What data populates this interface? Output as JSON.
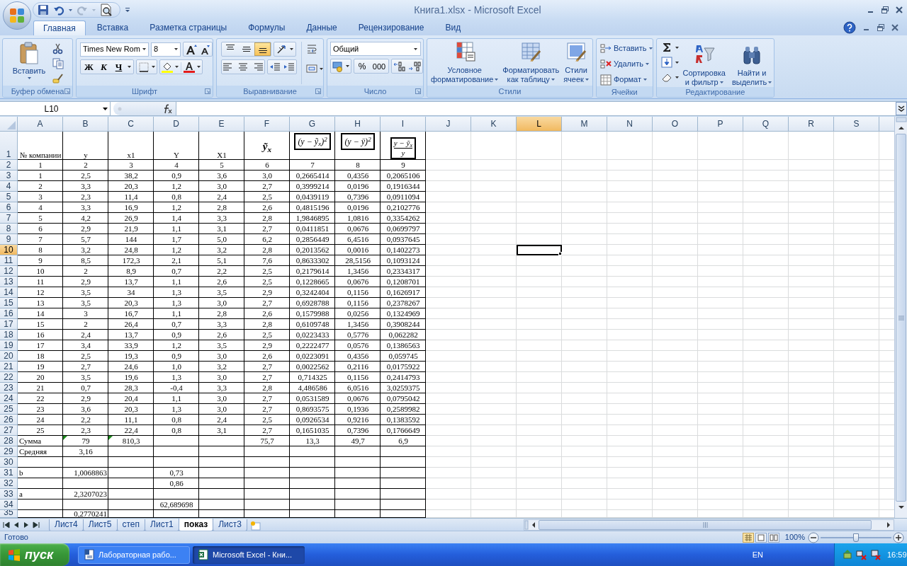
{
  "title_bar": {
    "title": "Книга1.xlsx - Microsoft Excel"
  },
  "tabs": [
    {
      "label": "Главная",
      "selected": true
    },
    {
      "label": "Вставка",
      "selected": false
    },
    {
      "label": "Разметка страницы",
      "selected": false
    },
    {
      "label": "Формулы",
      "selected": false
    },
    {
      "label": "Данные",
      "selected": false
    },
    {
      "label": "Рецензирование",
      "selected": false
    },
    {
      "label": "Вид",
      "selected": false
    }
  ],
  "clipboard": {
    "label": "Буфер обмена",
    "paste": "Вставить"
  },
  "font": {
    "label": "Шрифт",
    "name": "Times New Rom",
    "size": "8",
    "bold": "Ж",
    "italic": "К",
    "underline": "Ч"
  },
  "alignment": {
    "label": "Выравнивание",
    "vertical": [
      {
        "kind": "top",
        "selected": false
      },
      {
        "kind": "middle",
        "selected": false
      },
      {
        "kind": "bottom",
        "selected": true
      }
    ]
  },
  "number": {
    "label": "Число",
    "format": "Общий",
    "percent": "%",
    "thousands": "000"
  },
  "styles": {
    "label": "Стили",
    "buttons": [
      {
        "kind": "conditional",
        "lines": [
          "Условное",
          "форматирование"
        ]
      },
      {
        "kind": "table",
        "lines": [
          "Форматировать",
          "как таблицу"
        ]
      },
      {
        "kind": "cell",
        "lines": [
          "Стили",
          "ячеек"
        ]
      }
    ]
  },
  "cells_group": {
    "label": "Ячейки",
    "buttons": [
      {
        "kind": "insert",
        "label": "Вставить"
      },
      {
        "kind": "delete",
        "label": "Удалить"
      },
      {
        "kind": "format",
        "label": "Формат"
      }
    ]
  },
  "editing": {
    "label": "Редактирование",
    "buttons": [
      {
        "kind": "sort",
        "lines": [
          "Сортировка",
          "и фильтр"
        ]
      },
      {
        "kind": "find",
        "lines": [
          "Найти и",
          "выделить"
        ]
      }
    ]
  },
  "formula_bar": {
    "name_box": "L10"
  },
  "columns": [
    {
      "label": "A",
      "selected": false
    },
    {
      "label": "B",
      "selected": false
    },
    {
      "label": "C",
      "selected": false
    },
    {
      "label": "D",
      "selected": false
    },
    {
      "label": "E",
      "selected": false
    },
    {
      "label": "F",
      "selected": false
    },
    {
      "label": "G",
      "selected": false
    },
    {
      "label": "H",
      "selected": false
    },
    {
      "label": "I",
      "selected": false
    },
    {
      "label": "J",
      "selected": false
    },
    {
      "label": "K",
      "selected": false
    },
    {
      "label": "L",
      "selected": true
    },
    {
      "label": "M",
      "selected": false
    },
    {
      "label": "N",
      "selected": false
    },
    {
      "label": "O",
      "selected": false
    },
    {
      "label": "P",
      "selected": false
    },
    {
      "label": "Q",
      "selected": false
    },
    {
      "label": "R",
      "selected": false
    },
    {
      "label": "S",
      "selected": false
    }
  ],
  "rows": [
    {
      "number": "1",
      "selected": false,
      "kind": "header",
      "headers": [
        {
          "kind": "text",
          "text": "№ компании"
        },
        {
          "kind": "text",
          "text": "y"
        },
        {
          "kind": "text",
          "text": "x1"
        },
        {
          "kind": "text",
          "text": "Y"
        },
        {
          "kind": "text",
          "text": "X1"
        },
        {
          "kind": "symbol",
          "text": "ỹ$_{x}$"
        },
        {
          "kind": "boxed",
          "text": "(y − ỹ$_{x}$)$^{2}$"
        },
        {
          "kind": "boxed",
          "text": "(y − ȳ)$^{2}$"
        },
        {
          "kind": "fraction",
          "numerator": "y − ỹ$_{x}$",
          "denominator": "y"
        }
      ]
    },
    {
      "number": "2",
      "selected": false,
      "kind": "data",
      "cells": [
        "1",
        "2",
        "3",
        "4",
        "5",
        "6",
        "7",
        "8",
        "9"
      ]
    },
    {
      "number": "3",
      "selected": false,
      "kind": "data",
      "cells": [
        "1",
        "2,5",
        "38,2",
        "0,9",
        "3,6",
        "3,0",
        "0,2665414",
        "0,4356",
        "0,2065106"
      ]
    },
    {
      "number": "4",
      "selected": false,
      "kind": "data",
      "cells": [
        "2",
        "3,3",
        "20,3",
        "1,2",
        "3,0",
        "2,7",
        "0,3999214",
        "0,0196",
        "0,1916344"
      ]
    },
    {
      "number": "5",
      "selected": false,
      "kind": "data",
      "cells": [
        "3",
        "2,3",
        "11,4",
        "0,8",
        "2,4",
        "2,5",
        "0,0439119",
        "0,7396",
        "0,0911094"
      ]
    },
    {
      "number": "6",
      "selected": false,
      "kind": "data",
      "cells": [
        "4",
        "3,3",
        "16,9",
        "1,2",
        "2,8",
        "2,6",
        "0,4815196",
        "0,0196",
        "0,2102776"
      ]
    },
    {
      "number": "7",
      "selected": false,
      "kind": "data",
      "cells": [
        "5",
        "4,2",
        "26,9",
        "1,4",
        "3,3",
        "2,8",
        "1,9846895",
        "1,0816",
        "0,3354262"
      ]
    },
    {
      "number": "8",
      "selected": false,
      "kind": "data",
      "cells": [
        "6",
        "2,9",
        "21,9",
        "1,1",
        "3,1",
        "2,7",
        "0,0411851",
        "0,0676",
        "0,0699797"
      ]
    },
    {
      "number": "9",
      "selected": false,
      "kind": "data",
      "cells": [
        "7",
        "5,7",
        "144",
        "1,7",
        "5,0",
        "6,2",
        "0,2856449",
        "6,4516",
        "0,0937645"
      ]
    },
    {
      "number": "10",
      "selected": true,
      "kind": "data",
      "cells": [
        "8",
        "3,2",
        "24,8",
        "1,2",
        "3,2",
        "2,8",
        "0,2013562",
        "0,0016",
        "0,1402273"
      ]
    },
    {
      "number": "11",
      "selected": false,
      "kind": "data",
      "cells": [
        "9",
        "8,5",
        "172,3",
        "2,1",
        "5,1",
        "7,6",
        "0,8633302",
        "28,5156",
        "0,1093124"
      ]
    },
    {
      "number": "12",
      "selected": false,
      "kind": "data",
      "cells": [
        "10",
        "2",
        "8,9",
        "0,7",
        "2,2",
        "2,5",
        "0,2179614",
        "1,3456",
        "0,2334317"
      ]
    },
    {
      "number": "13",
      "selected": false,
      "kind": "data",
      "cells": [
        "11",
        "2,9",
        "13,7",
        "1,1",
        "2,6",
        "2,5",
        "0,1228665",
        "0,0676",
        "0,1208701"
      ]
    },
    {
      "number": "14",
      "selected": false,
      "kind": "data",
      "cells": [
        "12",
        "3,5",
        "34",
        "1,3",
        "3,5",
        "2,9",
        "0,3242404",
        "0,1156",
        "0,1626917"
      ]
    },
    {
      "number": "15",
      "selected": false,
      "kind": "data",
      "cells": [
        "13",
        "3,5",
        "20,3",
        "1,3",
        "3,0",
        "2,7",
        "0,6928788",
        "0,1156",
        "0,2378267"
      ]
    },
    {
      "number": "16",
      "selected": false,
      "kind": "data",
      "cells": [
        "14",
        "3",
        "16,7",
        "1,1",
        "2,8",
        "2,6",
        "0,1579988",
        "0,0256",
        "0,1324969"
      ]
    },
    {
      "number": "17",
      "selected": false,
      "kind": "data",
      "cells": [
        "15",
        "2",
        "26,4",
        "0,7",
        "3,3",
        "2,8",
        "0,6109748",
        "1,3456",
        "0,3908244"
      ]
    },
    {
      "number": "18",
      "selected": false,
      "kind": "data",
      "cells": [
        "16",
        "2,4",
        "13,7",
        "0,9",
        "2,6",
        "2,5",
        "0,0223433",
        "0,5776",
        "0,062282"
      ]
    },
    {
      "number": "19",
      "selected": false,
      "kind": "data",
      "cells": [
        "17",
        "3,4",
        "33,9",
        "1,2",
        "3,5",
        "2,9",
        "0,2222477",
        "0,0576",
        "0,1386563"
      ]
    },
    {
      "number": "20",
      "selected": false,
      "kind": "data",
      "cells": [
        "18",
        "2,5",
        "19,3",
        "0,9",
        "3,0",
        "2,6",
        "0,0223091",
        "0,4356",
        "0,059745"
      ]
    },
    {
      "number": "21",
      "selected": false,
      "kind": "data",
      "cells": [
        "19",
        "2,7",
        "24,6",
        "1,0",
        "3,2",
        "2,7",
        "0,0022562",
        "0,2116",
        "0,0175922"
      ]
    },
    {
      "number": "22",
      "selected": false,
      "kind": "data",
      "cells": [
        "20",
        "3,5",
        "19,6",
        "1,3",
        "3,0",
        "2,7",
        "0,714325",
        "0,1156",
        "0,2414793"
      ]
    },
    {
      "number": "23",
      "selected": false,
      "kind": "data",
      "cells": [
        "21",
        "0,7",
        "28,3",
        "-0,4",
        "3,3",
        "2,8",
        "4,486586",
        "6,0516",
        "3,0259375"
      ]
    },
    {
      "number": "24",
      "selected": false,
      "kind": "data",
      "cells": [
        "22",
        "2,9",
        "20,4",
        "1,1",
        "3,0",
        "2,7",
        "0,0531589",
        "0,0676",
        "0,0795042"
      ]
    },
    {
      "number": "25",
      "selected": false,
      "kind": "data",
      "cells": [
        "23",
        "3,6",
        "20,3",
        "1,3",
        "3,0",
        "2,7",
        "0,8693575",
        "0,1936",
        "0,2589982"
      ]
    },
    {
      "number": "26",
      "selected": false,
      "kind": "data",
      "cells": [
        "24",
        "2,2",
        "11,1",
        "0,8",
        "2,4",
        "2,5",
        "0,0926534",
        "0,9216",
        "0,1383592"
      ]
    },
    {
      "number": "27",
      "selected": false,
      "kind": "data",
      "cells": [
        "25",
        "2,3",
        "22,4",
        "0,8",
        "3,1",
        "2,7",
        "0,1651035",
        "0,7396",
        "0,1766649"
      ]
    },
    {
      "number": "28",
      "selected": false,
      "kind": "summary",
      "cells": [
        "Сумма",
        "79",
        "810,3",
        null,
        null,
        "75,7",
        "13,3",
        "49,7",
        "6,9"
      ],
      "error_marks": [
        false,
        true,
        true
      ]
    },
    {
      "number": "29",
      "selected": false,
      "kind": "summary",
      "cells": [
        "Средняя",
        "3,16"
      ]
    },
    {
      "number": "30",
      "selected": false,
      "kind": "extra"
    },
    {
      "number": "31",
      "selected": false,
      "kind": "extra",
      "cells": [
        "b",
        "1,0068863",
        null,
        "0,73"
      ]
    },
    {
      "number": "32",
      "selected": false,
      "kind": "extra",
      "cells": [
        null,
        null,
        null,
        "0,86"
      ]
    },
    {
      "number": "33",
      "selected": false,
      "kind": "extra",
      "cells": [
        "a",
        "2,3207023"
      ]
    },
    {
      "number": "34",
      "selected": false,
      "kind": "extra",
      "cells": [
        null,
        null,
        null,
        "62,689698"
      ]
    },
    {
      "number": "35",
      "selected": false,
      "kind": "extra",
      "cells": [
        null,
        "0,2770241"
      ]
    }
  ],
  "sheet_tabs": [
    {
      "label": "Лист4",
      "selected": false
    },
    {
      "label": "Лист5",
      "selected": false
    },
    {
      "label": "степ",
      "selected": false
    },
    {
      "label": "Лист1",
      "selected": false
    },
    {
      "label": "показ",
      "selected": true
    },
    {
      "label": "Лист3",
      "selected": false
    }
  ],
  "status_bar": {
    "text": "Готово",
    "zoom": "100%",
    "zoom_level": {
      "level": 0.5
    }
  },
  "taskbar": {
    "start": "пуск",
    "tasks": [
      {
        "label": "Лабораторная рабо...",
        "selected": false
      },
      {
        "label": "Microsoft Excel - Кни...",
        "selected": true
      }
    ],
    "language": "EN",
    "clock": "16:59"
  }
}
